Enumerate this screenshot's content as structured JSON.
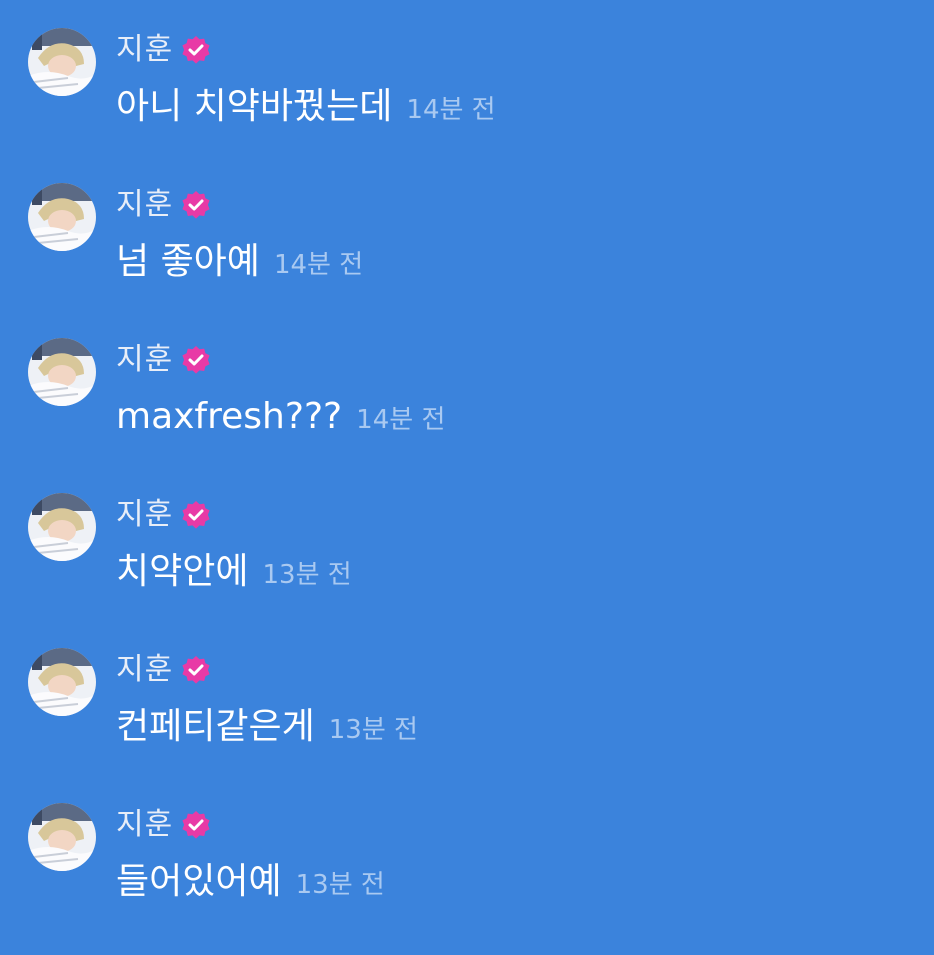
{
  "colors": {
    "background": "#3b83dc",
    "badge": "#e83aa6",
    "name_text": "#e8eef8",
    "message_text": "#ffffff",
    "time_text": "#a9c9f1"
  },
  "messages": [
    {
      "sender": "지훈",
      "verified_icon": "verified-badge-icon",
      "avatar_icon": "avatar",
      "text": "아니 치약바꿨는데",
      "time": "14분 전"
    },
    {
      "sender": "지훈",
      "verified_icon": "verified-badge-icon",
      "avatar_icon": "avatar",
      "text": "넘 좋아예",
      "time": "14분 전"
    },
    {
      "sender": "지훈",
      "verified_icon": "verified-badge-icon",
      "avatar_icon": "avatar",
      "text": "maxfresh???",
      "time": "14분 전"
    },
    {
      "sender": "지훈",
      "verified_icon": "verified-badge-icon",
      "avatar_icon": "avatar",
      "text": "치약안에",
      "time": "13분 전"
    },
    {
      "sender": "지훈",
      "verified_icon": "verified-badge-icon",
      "avatar_icon": "avatar",
      "text": "컨페티같은게",
      "time": "13분 전"
    },
    {
      "sender": "지훈",
      "verified_icon": "verified-badge-icon",
      "avatar_icon": "avatar",
      "text": "들어있어예",
      "time": "13분 전"
    }
  ]
}
